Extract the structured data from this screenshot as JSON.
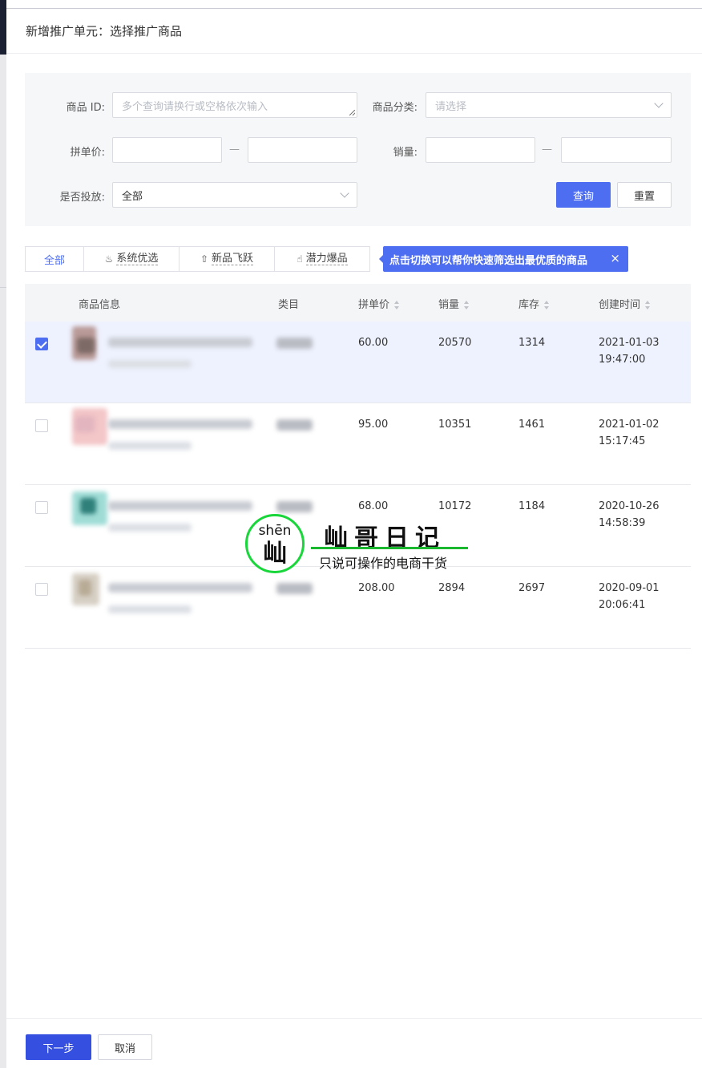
{
  "header": {
    "title": "新增推广单元：选择推广商品"
  },
  "filters": {
    "product_id": {
      "label": "商品 ID:",
      "placeholder": "多个查询请换行或空格依次输入"
    },
    "category": {
      "label": "商品分类:",
      "placeholder": "请选择"
    },
    "price": {
      "label": "拼单价:",
      "separator": "—"
    },
    "sales": {
      "label": "销量:",
      "separator": "—"
    },
    "delivery": {
      "label": "是否投放:",
      "value": "全部"
    },
    "query_label": "查询",
    "reset_label": "重置"
  },
  "tabs": [
    {
      "label": "全部",
      "icon": ""
    },
    {
      "label": "系统优选",
      "icon": "flame-icon"
    },
    {
      "label": "新品飞跃",
      "icon": "rocket-icon"
    },
    {
      "label": "潜力爆品",
      "icon": "thumbs-up-icon"
    }
  ],
  "tooltip": {
    "text": "点击切换可以帮你快速筛选出最优质的商品",
    "close": "×"
  },
  "table": {
    "columns": [
      "商品信息",
      "类目",
      "拼单价",
      "销量",
      "库存",
      "创建时间"
    ],
    "rows": [
      {
        "checked": true,
        "price": "60.00",
        "sales": "20570",
        "stock": "1314",
        "date": "2021-01-03",
        "time": "19:47:00"
      },
      {
        "checked": false,
        "price": "95.00",
        "sales": "10351",
        "stock": "1461",
        "date": "2021-01-02",
        "time": "15:17:45"
      },
      {
        "checked": false,
        "price": "68.00",
        "sales": "10172",
        "stock": "1184",
        "date": "2020-10-26",
        "time": "14:58:39"
      },
      {
        "checked": false,
        "price": "208.00",
        "sales": "2894",
        "stock": "2697",
        "date": "2020-09-01",
        "time": "20:06:41"
      }
    ]
  },
  "footer": {
    "next_label": "下一步",
    "cancel_label": "取消"
  },
  "watermark": {
    "pinyin": "shēn",
    "char": "屾",
    "title": "屾哥日记",
    "subtitle": "只说可操作的电商干货"
  },
  "colors": {
    "primary": "#4e6ef2",
    "selected_row": "#eef2fe",
    "watermark_green": "#19d63a"
  }
}
